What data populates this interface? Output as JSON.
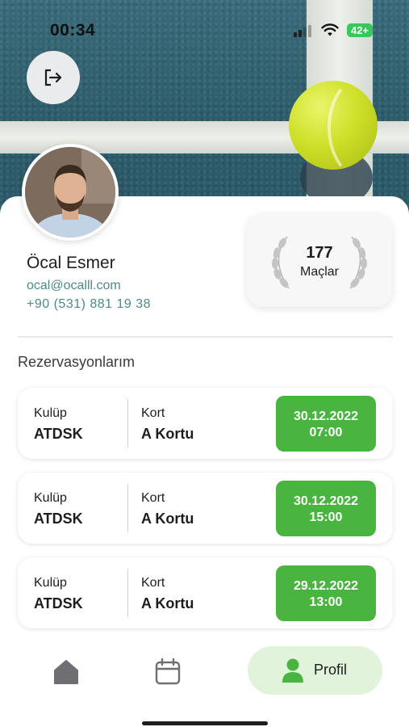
{
  "status_bar": {
    "time": "00:34",
    "battery": "42+"
  },
  "header": {
    "logout_icon": "logout-icon"
  },
  "profile": {
    "name": "Öcal Esmer",
    "email": "ocal@ocalll.com",
    "phone": "+90 (531) 881 19 38"
  },
  "stats": {
    "matches_count": "177",
    "matches_label": "Maçlar"
  },
  "reservations": {
    "title": "Rezervasyonlarım",
    "items": [
      {
        "club_label": "Kulüp",
        "club": "ATDSK",
        "court_label": "Kort",
        "court": "A Kortu",
        "date": "30.12.2022",
        "time": "07:00"
      },
      {
        "club_label": "Kulüp",
        "club": "ATDSK",
        "court_label": "Kort",
        "court": "A Kortu",
        "date": "30.12.2022",
        "time": "15:00"
      },
      {
        "club_label": "Kulüp",
        "club": "ATDSK",
        "court_label": "Kort",
        "court": "A Kortu",
        "date": "29.12.2022",
        "time": "13:00"
      }
    ]
  },
  "nav": {
    "home_icon": "home-icon",
    "calendar_icon": "calendar-icon",
    "profile_label": "Profil"
  },
  "colors": {
    "accent_green": "#49b43f",
    "profile_pill": "#e2f3dc",
    "link_teal": "#4d8a8a"
  }
}
